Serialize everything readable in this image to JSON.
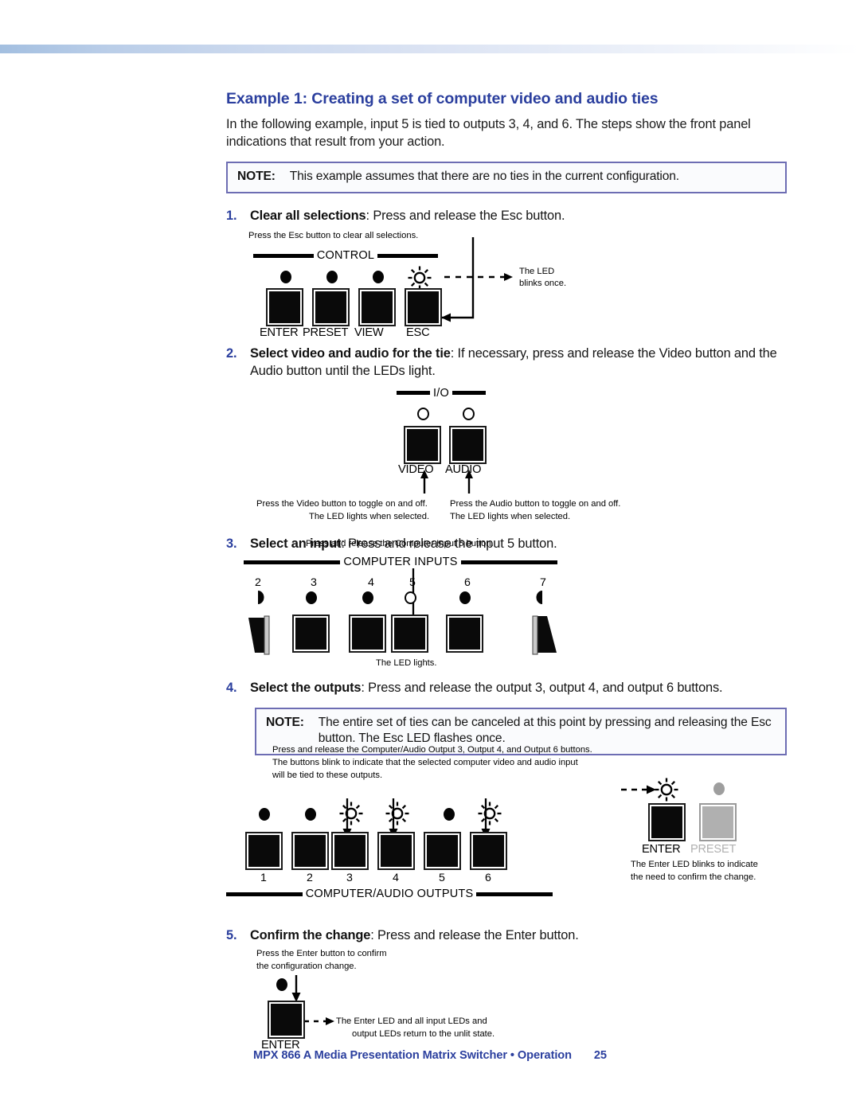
{
  "document": {
    "heading": "Example 1: Creating a set of computer video and audio ties",
    "intro": "In the following example, input 5 is tied to outputs 3, 4, and 6. The steps show the front panel indications that result from your action.",
    "colors": {
      "heading_blue": "#2b3f9e",
      "note_border": "#6d6db3",
      "note_fill": "#fafbfd",
      "rule_gradient_start": "#a3bfe0",
      "panel_black": "#0a0a0a",
      "panel_grey": "#b0b0b0"
    }
  },
  "note_top": {
    "label": "NOTE:",
    "text": "This example assumes that there are no ties in the current configuration."
  },
  "steps": [
    {
      "number": "1.",
      "bold": "Clear all selections",
      "rest": ": Press and release the Esc button."
    },
    {
      "number": "2.",
      "bold": "Select video and audio for the tie",
      "rest": ": If necessary, press and release the Video button and the Audio button until the LEDs light."
    },
    {
      "number": "3.",
      "bold": "Select an input",
      "rest": ": Press and release the input 5 button."
    },
    {
      "number": "4.",
      "bold": "Select the outputs",
      "rest": ": Press and release the output 3, output 4, and output 6 buttons."
    },
    {
      "number": "5.",
      "bold": "Confirm the change",
      "rest": ": Press and release the Enter button."
    }
  ],
  "note_step4": {
    "label": "NOTE:",
    "text": "The entire set of ties can be canceled at this point by pressing and releasing the Esc button. The Esc LED flashes once."
  },
  "fig_control": {
    "callout_top": "Press the Esc button to clear all selections.",
    "section_label": "CONTROL",
    "callout_led_line1": "The LED",
    "callout_led_line2": "blinks once.",
    "buttons": [
      {
        "label": "ENTER",
        "led": "filled"
      },
      {
        "label": "PRESET",
        "led": "filled"
      },
      {
        "label": "VIEW",
        "led": "filled"
      },
      {
        "label": "ESC",
        "led": "blinking"
      }
    ]
  },
  "fig_io": {
    "section_label": "I/O",
    "buttons": [
      {
        "label": "VIDEO",
        "led": "lit"
      },
      {
        "label": "AUDIO",
        "led": "lit"
      }
    ],
    "note_video_line1": "Press the Video button to toggle on and off.",
    "note_video_line2": "The LED lights when selected.",
    "note_audio_line1": "Press the Audio button to toggle on and off.",
    "note_audio_line2": "The LED lights when selected."
  },
  "fig_inputs": {
    "callout_top": "Press and release the Computer Input 5 button.",
    "section_label": "COMPUTER INPUTS",
    "numbers": [
      "2",
      "3",
      "4",
      "5",
      "6",
      "7"
    ],
    "led_states": [
      "filled",
      "filled",
      "filled",
      "lit",
      "filled",
      "filled"
    ],
    "callout_bottom": "The LED lights."
  },
  "fig_outputs": {
    "callout_line1": "Press and release the Computer/Audio Output 3, Output 4, and Output 6 buttons.",
    "callout_line2": "The buttons blink to indicate that the selected computer video and audio input",
    "callout_line3": "will be tied to these outputs.",
    "numbers": [
      "1",
      "2",
      "3",
      "4",
      "5",
      "6"
    ],
    "led_states": [
      "filled",
      "filled",
      "blinking",
      "blinking",
      "filled",
      "blinking"
    ],
    "section_label": "COMPUTER/AUDIO OUTPUTS",
    "enter_label": "ENTER",
    "preset_label": "PRESET",
    "enter_note_line1": "The Enter LED blinks to indicate",
    "enter_note_line2": "the need to confirm the change."
  },
  "fig_confirm": {
    "callout_line1": "Press the Enter button to confirm",
    "callout_line2": "the configuration change.",
    "enter_label": "ENTER",
    "result_line1": "The Enter LED and all input LEDs and",
    "result_line2": "output LEDs return to the unlit state."
  },
  "footer": {
    "text": "MPX 866 A Media Presentation Matrix Switcher • Operation",
    "page": "25"
  }
}
